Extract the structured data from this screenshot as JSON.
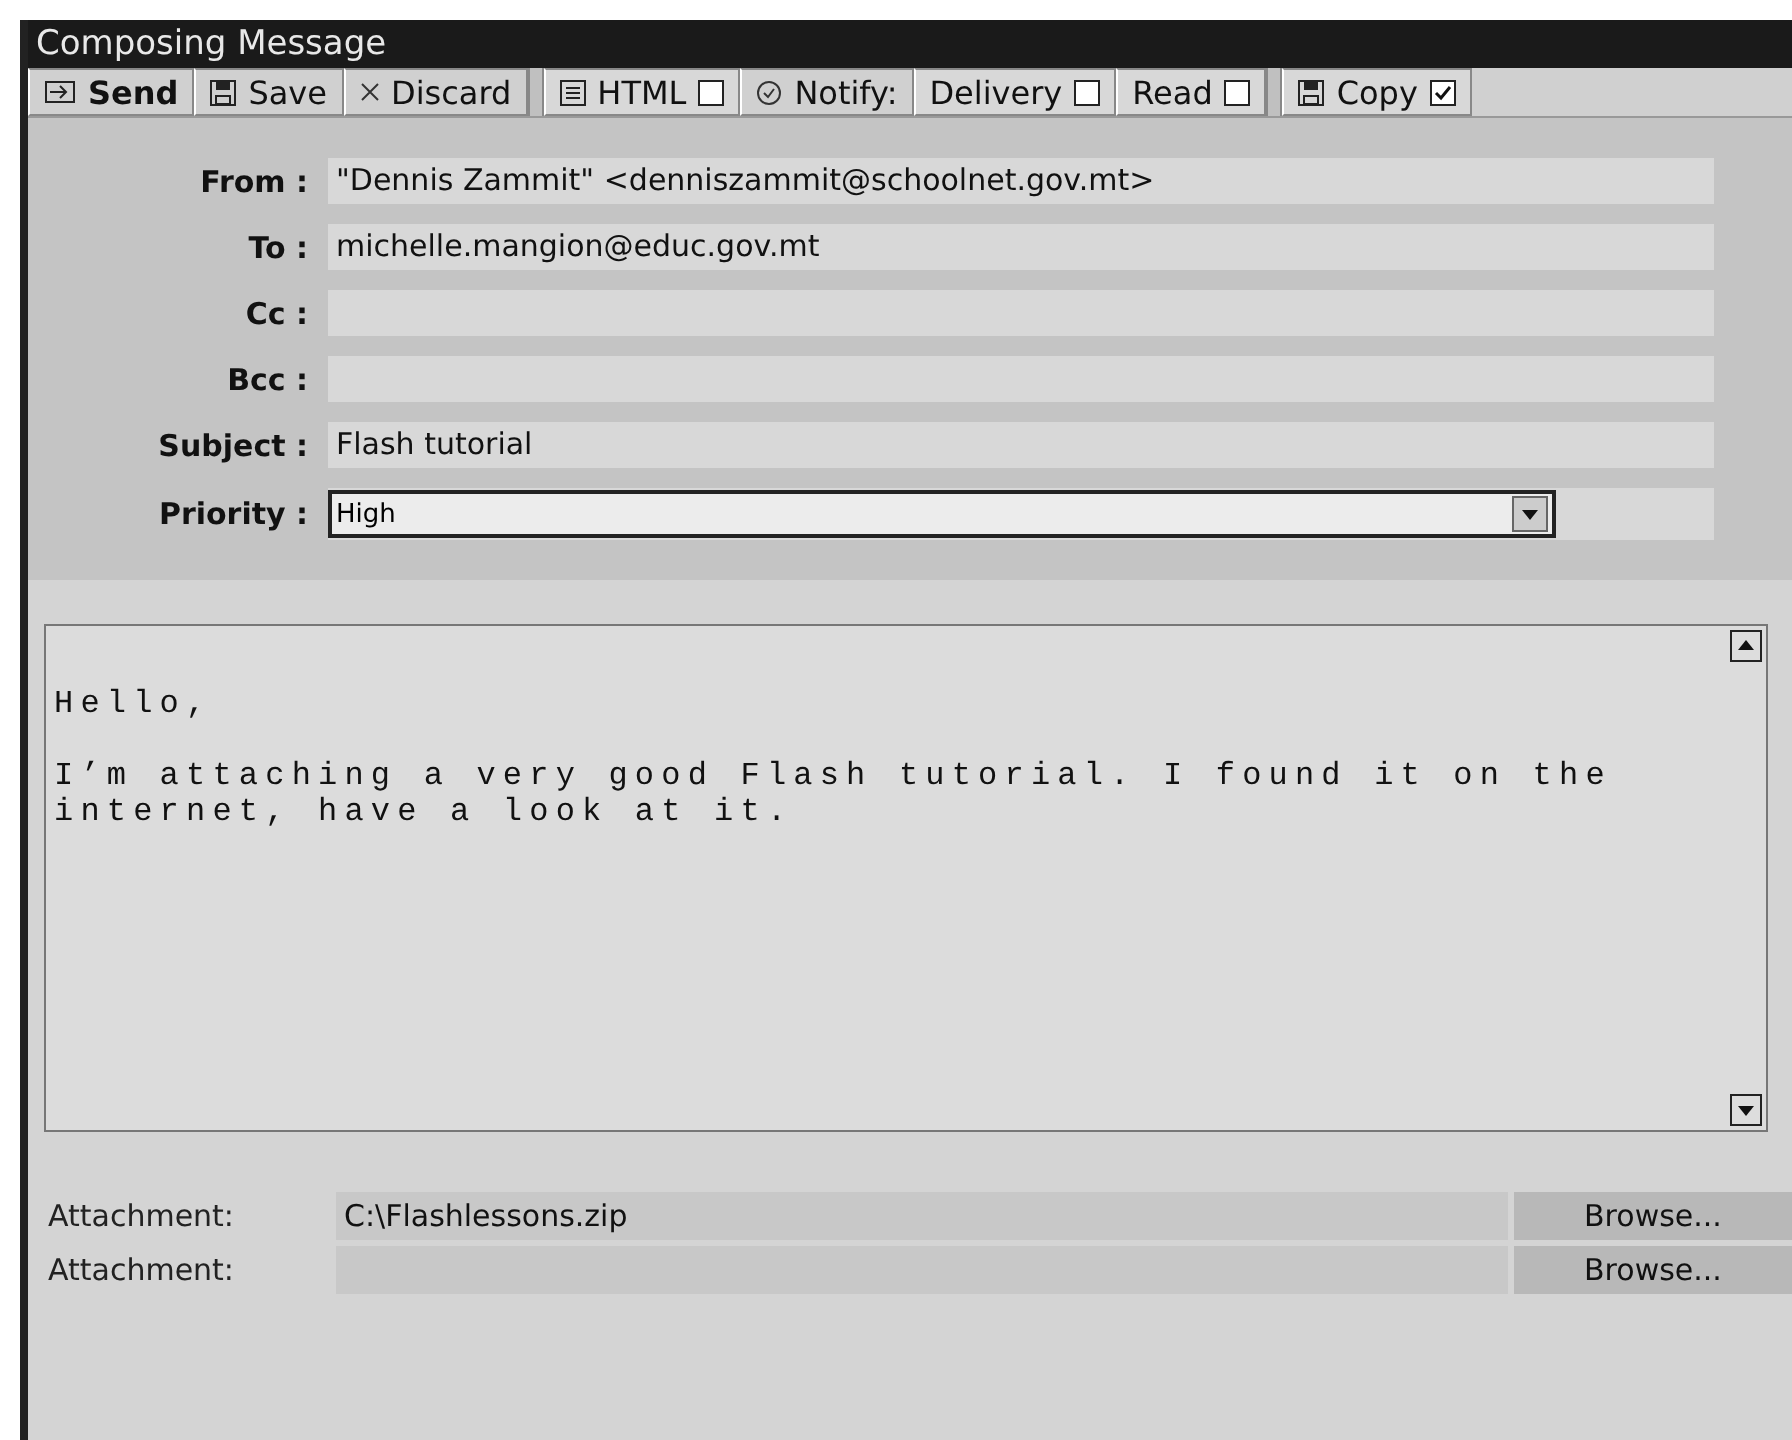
{
  "window": {
    "title": "Composing Message"
  },
  "toolbar": [
    {
      "kind": "primary",
      "label": "Send"
    },
    {
      "kind": "button",
      "label": "Save"
    },
    {
      "kind": "button",
      "label": "Discard"
    },
    {
      "kind": "separator"
    },
    {
      "kind": "check",
      "label": "HTML",
      "checked": false
    },
    {
      "kind": "label",
      "label": "Notify:"
    },
    {
      "kind": "check",
      "label": "Delivery",
      "checked": false
    },
    {
      "kind": "check",
      "label": "Read",
      "checked": false
    },
    {
      "kind": "separator"
    },
    {
      "kind": "check",
      "label": "Copy",
      "checked": true
    }
  ],
  "fields": [
    {
      "label": "From :",
      "value": "\"Dennis Zammit\" <denniszammit@schoolnet.gov.mt>"
    },
    {
      "label": "To :",
      "value": "michelle.mangion@educ.gov.mt"
    },
    {
      "label": "Cc :"
    },
    {
      "label": "Bcc :"
    },
    {
      "label": "Subject :",
      "value": "Flash tutorial"
    }
  ],
  "priority": {
    "label": "Priority :",
    "value": "High"
  },
  "message": {
    "paragraphs": [
      "Hello,",
      "I’m attaching a very good Flash tutorial. I found it on the internet, have a look at it."
    ]
  },
  "attachments": [
    {
      "label": "Attachment:",
      "value": "C:\\Flashlessons.zip",
      "button": "Browse..."
    },
    {
      "label": "Attachment:",
      "button": "Browse..."
    }
  ]
}
